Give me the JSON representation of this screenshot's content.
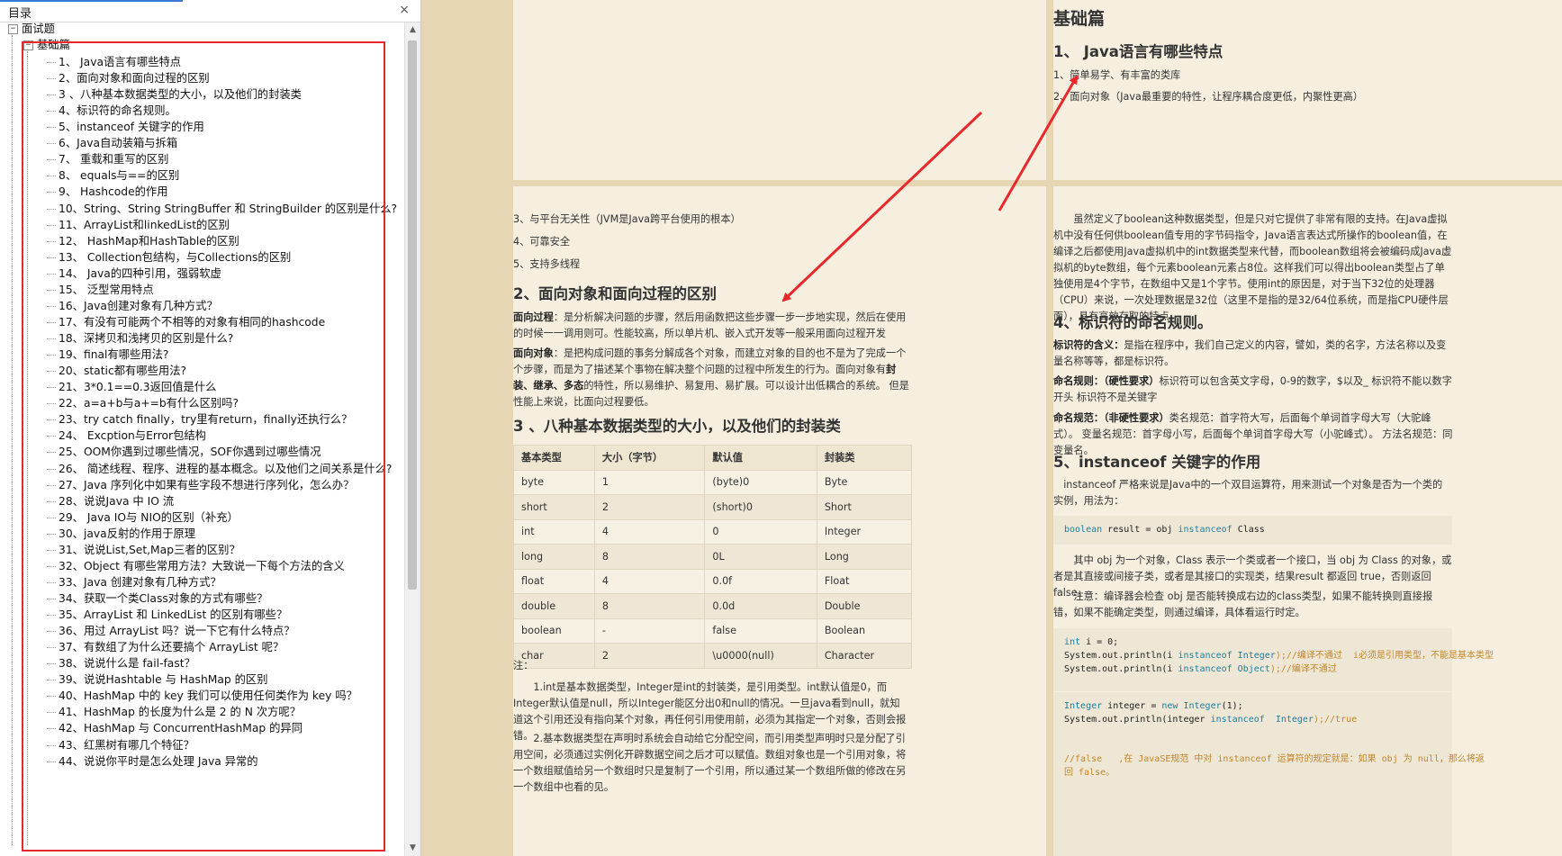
{
  "sidebar": {
    "title": "目录",
    "close": "×",
    "root": "面试题",
    "section": "基础篇",
    "items": [
      "1、 Java语言有哪些特点",
      "2、面向对象和面向过程的区别",
      "3 、八种基本数据类型的大小，以及他们的封装类",
      "4、标识符的命名规则。",
      "5、instanceof 关键字的作用",
      "6、Java自动装箱与拆箱",
      "7、 重载和重写的区别",
      "8、 equals与==的区别",
      "9、 Hashcode的作用",
      "10、String、String StringBuffer 和 StringBuilder 的区别是什么?",
      "11、ArrayList和linkedList的区别",
      "12、 HashMap和HashTable的区别",
      "13、 Collection包结构，与Collections的区别",
      "14、 Java的四种引用，强弱软虚",
      "15、 泛型常用特点",
      "16、Java创建对象有几种方式？",
      "17、有没有可能两个不相等的对象有相同的hashcode",
      "18、深拷贝和浅拷贝的区别是什么?",
      "19、final有哪些用法?",
      "20、static都有哪些用法?",
      "21、3*0.1==0.3返回值是什么",
      "22、a=a+b与a+=b有什么区别吗?",
      "23、try catch finally，try里有return，finally还执行么？",
      "24、 Excption与Error包结构",
      "25、OOM你遇到过哪些情况，SOF你遇到过哪些情况",
      "26、 简述线程、程序、进程的基本概念。以及他们之间关系是什么?",
      "27、Java 序列化中如果有些字段不想进行序列化，怎么办？",
      "28、说说Java 中 IO 流",
      "29、 Java IO与 NIO的区别（补充）",
      "30、java反射的作用于原理",
      "31、说说List,Set,Map三者的区别？",
      "32、Object 有哪些常用方法？大致说一下每个方法的含义",
      "33、Java 创建对象有几种方式？",
      "34、获取一个类Class对象的方式有哪些？",
      "35、ArrayList 和 LinkedList 的区别有哪些？",
      "36、用过 ArrayList 吗？说一下它有什么特点？",
      "37、有数组了为什么还要搞个 ArrayList 呢？",
      "38、说说什么是 fail-fast？",
      "39、说说Hashtable 与 HashMap 的区别",
      "40、HashMap 中的 key 我们可以使用任何类作为 key 吗？",
      "41、HashMap 的长度为什么是 2 的 N 次方呢？",
      "42、HashMap 与 ConcurrentHashMap 的异同",
      "43、红黑树有哪几个特征？",
      "44、说说你平时是怎么处理 Java 异常的"
    ]
  },
  "doc": {
    "p2": {
      "h1": "基础篇",
      "h2": "1、 Java语言有哪些特点",
      "l1": "1、简单易学、有丰富的类库",
      "l2": "2、面向对象（Java最重要的特性，让程序耦合度更低，内聚性更高）"
    },
    "p3": {
      "l3": "3、与平台无关性（JVM是Java跨平台使用的根本）",
      "l4": "4、可靠安全",
      "l5": "5、支持多线程",
      "h2a": "2、面向对象和面向过程的区别",
      "proc_label": "面向过程",
      "proc_text": "：是分析解决问题的步骤，然后用函数把这些步骤一步一步地实现，然后在使用的时候一一调用则可。性能较高，所以单片机、嵌入式开发等一般采用面向过程开发",
      "obj_label": "面向对象",
      "obj_text1": "：是把构成问题的事务分解成各个对象，而建立对象的目的也不是为了完成一个个步骤，而是为了描述某个事物在解决整个问题的过程中所发生的行为。面向对象有",
      "obj_bold": "封装、继承、多态",
      "obj_text2": "的特性，所以易维护、易复用、易扩展。可以设计出低耦合的系统。 但是性能上来说，比面向过程要低。",
      "h2b": "3 、八种基本数据类型的大小，以及他们的封装类",
      "table_headers": [
        "基本类型",
        "大小（字节）",
        "默认值",
        "封装类"
      ],
      "table_rows": [
        [
          "byte",
          "1",
          "(byte)0",
          "Byte"
        ],
        [
          "short",
          "2",
          "(short)0",
          "Short"
        ],
        [
          "int",
          "4",
          "0",
          "Integer"
        ],
        [
          "long",
          "8",
          "0L",
          "Long"
        ],
        [
          "float",
          "4",
          "0.0f",
          "Float"
        ],
        [
          "double",
          "8",
          "0.0d",
          "Double"
        ],
        [
          "boolean",
          "-",
          "false",
          "Boolean"
        ],
        [
          "char",
          "2",
          "\\u0000(null)",
          "Character"
        ]
      ],
      "note": "注：",
      "note1": "1.int是基本数据类型，Integer是int的封装类，是引用类型。int默认值是0，而Integer默认值是null，所以Integer能区分出0和null的情况。一旦java看到null，就知道这个引用还没有指向某个对象，再任何引用使用前，必须为其指定一个对象，否则会报错。",
      "note2": "2.基本数据类型在声明时系统会自动给它分配空间，而引用类型声明时只是分配了引用空间，必须通过实例化开辟数据空间之后才可以赋值。数组对象也是一个引用对象，将一个数组赋值给另一个数组时只是复制了一个引用，所以通过某一个数组所做的修改在另一个数组中也看的见。"
    },
    "p4": {
      "bool_para": "虽然定义了boolean这种数据类型，但是只对它提供了非常有限的支持。在Java虚拟机中没有任何供boolean值专用的字节码指令，Java语言表达式所操作的boolean值，在编译之后都使用Java虚拟机中的int数据类型来代替，而boolean数组将会被编码成Java虚拟机的byte数组，每个元素boolean元素占8位。这样我们可以得出boolean类型占了单独使用是4个字节，在数组中又是1个字节。使用int的原因是，对于当下32位的处理器（CPU）来说，一次处理数据是32位（这里不是指的是32/64位系统，而是指CPU硬件层面），具有高效存取的特点。",
      "h2c": "4、标识符的命名规则。",
      "id_label": "标识符的含义：",
      "id_text": "是指在程序中，我们自己定义的内容，譬如，类的名字，方法名称以及变量名称等等，都是标识符。",
      "rule_label": "命名规则：（硬性要求）",
      "rule_text": "标识符可以包含英文字母，0-9的数字，$以及_ 标识符不能以数字开头 标识符不是关键字",
      "spec_label": "命名规范：（非硬性要求）",
      "spec_text": "类名规范：首字符大写，后面每个单词首字母大写（大驼峰式）。 变量名规范：首字母小写，后面每个单词首字母大写（小驼峰式）。 方法名规范：同变量名。",
      "h2d": "5、instanceof 关键字的作用",
      "inst_para": "instanceof 严格来说是Java中的一个双目运算符，用来测试一个对象是否为一个类的实例，用法为：",
      "code1_kw1": "boolean",
      "code1_mid": " result = obj ",
      "code1_kw2": "instanceof",
      "code1_end": " Class",
      "obj_para": "其中 obj 为一个对象，Class 表示一个类或者一个接口，当 obj 为 Class 的对象，或者是其直接或间接子类，或者是其接口的实现类，结果result 都返回 true，否则返回false。",
      "note_para": "注意：编译器会检查 obj 是否能转换成右边的class类型，如果不能转换则直接报错，如果不能确定类型，则通过编译，具体看运行时定。",
      "code2_l1a": "int",
      "code2_l1b": " i = 0;",
      "code2_l2a": "System.out.println(i ",
      "code2_l2kw": "instanceof",
      "code2_l2t": " Integer",
      "code2_l2c": ");//编译不通过  i必须是引用类型，不能是基本类型",
      "code2_l3a": "System.out.println(i ",
      "code2_l3kw": "instanceof",
      "code2_l3t": " Object",
      "code2_l3c": ");//编译不通过",
      "code3_l1a": "Integer",
      "code3_l1b": " integer = ",
      "code3_l1c": "new",
      "code3_l1d": " Integer",
      "code3_l1e": "(1);",
      "code3_l2a": "System.out.println(integer ",
      "code3_l2kw": "instanceof",
      "code3_l2t": "  Integer",
      "code3_l2c": ");//true",
      "code4_l1": "//false   ,在 JavaSE规范 中对 instanceof 运算符的规定就是：如果 obj 为 null，那么将返",
      "code4_l2": "回 false。"
    }
  },
  "colors": {
    "highlight": "#e8282b",
    "arrow": "#e8282b",
    "page_bg": "#f6efdf",
    "doc_bg": "#e6d6b4"
  }
}
